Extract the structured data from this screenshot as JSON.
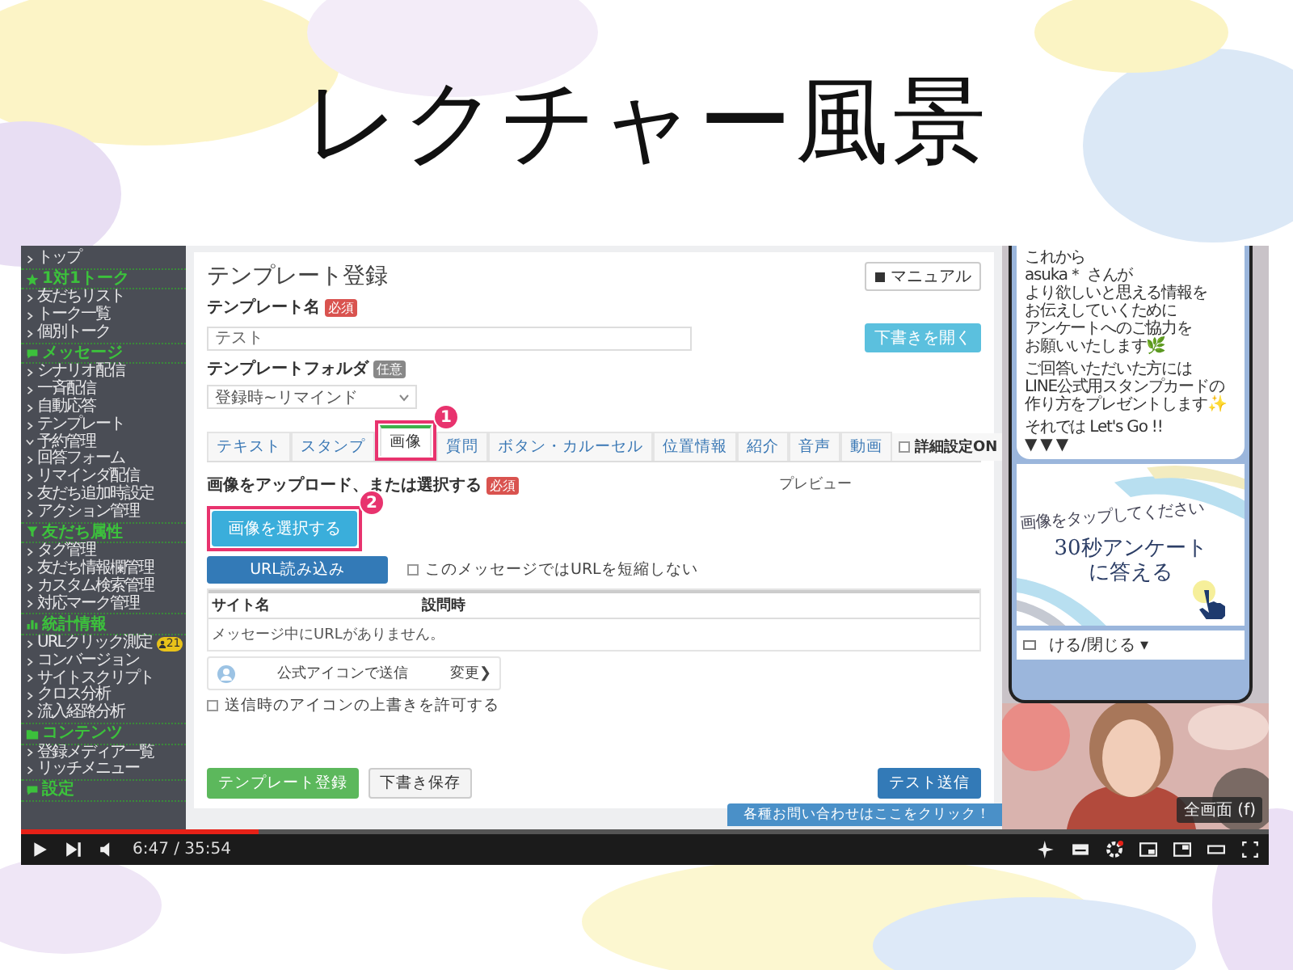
{
  "slide": {
    "title": "レクチャー風景"
  },
  "sidebar": [
    {
      "kind": "item",
      "label": "トップ",
      "expanded": false
    },
    {
      "kind": "section",
      "label": "1対1トーク"
    },
    {
      "kind": "item",
      "label": "友だちリスト",
      "expanded": false
    },
    {
      "kind": "item",
      "label": "トーク一覧",
      "expanded": false
    },
    {
      "kind": "item",
      "label": "個別トーク",
      "expanded": false
    },
    {
      "kind": "section",
      "label": "メッセージ"
    },
    {
      "kind": "item",
      "label": "シナリオ配信",
      "expanded": false
    },
    {
      "kind": "item",
      "label": "一斉配信",
      "expanded": false
    },
    {
      "kind": "item",
      "label": "自動応答",
      "expanded": false
    },
    {
      "kind": "item",
      "label": "テンプレート",
      "expanded": false
    },
    {
      "kind": "item",
      "label": "予約管理",
      "expanded": true
    },
    {
      "kind": "item",
      "label": "回答フォーム",
      "expanded": false
    },
    {
      "kind": "item",
      "label": "リマインダ配信",
      "expanded": false
    },
    {
      "kind": "item",
      "label": "友だち追加時設定",
      "expanded": false
    },
    {
      "kind": "item",
      "label": "アクション管理",
      "expanded": false
    },
    {
      "kind": "section",
      "label": "友だち属性"
    },
    {
      "kind": "item",
      "label": "タグ管理",
      "expanded": false
    },
    {
      "kind": "item",
      "label": "友だち情報欄管理",
      "expanded": false
    },
    {
      "kind": "item",
      "label": "カスタム検索管理",
      "expanded": false
    },
    {
      "kind": "item",
      "label": "対応マーク管理",
      "expanded": false
    },
    {
      "kind": "section",
      "label": "統計情報"
    },
    {
      "kind": "item",
      "label": "URLクリック測定",
      "expanded": false,
      "badge": "21"
    },
    {
      "kind": "item",
      "label": "コンバージョン",
      "expanded": false
    },
    {
      "kind": "item",
      "label": "サイトスクリプト",
      "expanded": false
    },
    {
      "kind": "item",
      "label": "クロス分析",
      "expanded": false
    },
    {
      "kind": "item",
      "label": "流入経路分析",
      "expanded": false
    },
    {
      "kind": "section",
      "label": "コンテンツ"
    },
    {
      "kind": "item",
      "label": "登録メディア一覧",
      "expanded": false
    },
    {
      "kind": "item",
      "label": "リッチメニュー",
      "expanded": false
    },
    {
      "kind": "section",
      "label": "設定"
    }
  ],
  "form": {
    "title": "テンプレート登録",
    "manual_button": "マニュアル",
    "draft_open_button": "下書きを開く",
    "name_field": {
      "label": "テンプレート名",
      "badge": "必須",
      "value": "テスト"
    },
    "folder_field": {
      "label": "テンプレートフォルダ",
      "badge": "任意",
      "value": "登録時~リマインド"
    },
    "tabs": [
      {
        "label": "テキスト",
        "selected": false
      },
      {
        "label": "スタンプ",
        "selected": false
      },
      {
        "label": "画像",
        "selected": true,
        "highlight": "1"
      },
      {
        "label": "質問",
        "selected": false
      },
      {
        "label": "ボタン・カルーセル",
        "selected": false
      },
      {
        "label": "位置情報",
        "selected": false
      },
      {
        "label": "紹介",
        "selected": false
      },
      {
        "label": "音声",
        "selected": false
      },
      {
        "label": "動画",
        "selected": false
      }
    ],
    "advanced": {
      "label": "詳細設定ON",
      "checked": false
    },
    "upload_label": "画像をアップロード、または選択する",
    "upload_badge": "必須",
    "select_image_button": {
      "label": "画像を選択する",
      "highlight": "2"
    },
    "preview_label": "プレビュー",
    "url_button": "URL読み込み",
    "shorten_checkbox": {
      "label": "このメッセージではURLを短縮しない",
      "checked": false
    },
    "table": {
      "columns": [
        "サイト名",
        "設問時"
      ],
      "empty_message": "メッセージ中にURLがありません。"
    },
    "icon_card": {
      "label": "公式アイコンで送信",
      "change": "変更❯"
    },
    "override_checkbox": {
      "label": "送信時のアイコンの上書きを許可する",
      "checked": false
    },
    "footer_buttons": [
      {
        "label": "テンプレート登録",
        "kind": "primary"
      },
      {
        "label": "下書き保存",
        "kind": "default"
      },
      {
        "label": "テスト送信",
        "kind": "info"
      }
    ],
    "contact_banner": "各種お問い合わせはここをクリック！"
  },
  "phone": {
    "message": [
      [
        "これから",
        "asuka＊ さんが",
        "より欲しいと思える情報を",
        "お伝えしていくために",
        "アンケートへのご協力を",
        "お願いいたします🌿"
      ],
      [
        "ご回答いただいた方には",
        "LINE公式用スタンプカードの",
        "作り方をプレゼントします✨"
      ],
      [
        "それでは Let's Go !!",
        "▼ ▼ ▼"
      ]
    ],
    "card": {
      "hint": "画像をタップしてください",
      "headline": [
        "30秒アンケート",
        "に答える"
      ]
    },
    "menu_bar": "ける/閉じる ▾"
  },
  "player": {
    "progress": {
      "level": 0.19
    },
    "time": "6:47 / 35:54",
    "tooltip": "全画面 (f)"
  }
}
